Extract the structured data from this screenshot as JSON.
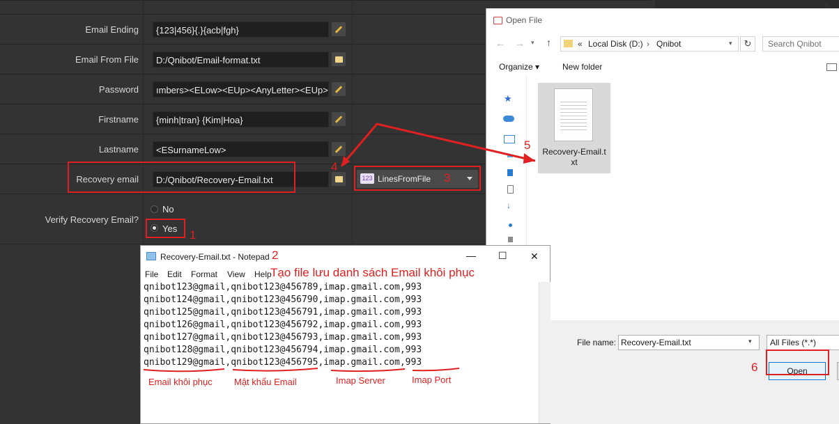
{
  "settings": {
    "rows": [
      {
        "label": "Email Ending",
        "value": "{123|456}{.}{acb|fgh}",
        "button": "pencil"
      },
      {
        "label": "Email From File",
        "value": "D:/Qnibot/Email-format.txt",
        "button": "folder"
      },
      {
        "label": "Password",
        "value": "ımbers><ELow><EUp><AnyLetter><EUp>",
        "button": "pencil"
      },
      {
        "label": "Firstname",
        "value": "{minh|tran} {Kim|Hoa}",
        "button": "pencil"
      },
      {
        "label": "Lastname",
        "value": "<ESurnameLow>",
        "button": "pencil"
      },
      {
        "label": "Recovery email",
        "value": "D:/Qnibot/Recovery-Email.txt",
        "button": "folder"
      }
    ],
    "combo": {
      "badge": "123",
      "value": "LinesFromFile"
    },
    "verify_label": "Verify Recovery Email?",
    "radio_no": "No",
    "radio_yes": "Yes"
  },
  "open_dialog": {
    "title": "Open File",
    "address": {
      "prefix": "«",
      "path1": "Local Disk (D:)",
      "sep": "›",
      "path2": "Qnibot"
    },
    "search_placeholder": "Search Qnibot",
    "organize": "Organize ▾",
    "new_folder": "New folder",
    "file_name": "Recovery-Email.txt",
    "file_name_label": "File name:",
    "file_name_value": "Recovery-Email.txt",
    "file_type": "All Files (*.*)",
    "open_button": "Open"
  },
  "notepad": {
    "title": "Recovery-Email.txt - Notepad",
    "menu": [
      "File",
      "Edit",
      "Format",
      "View",
      "Help"
    ],
    "lines": [
      "qnibot123@gmail,qnibot123@456789,imap.gmail.com,993",
      "qnibot124@gmail,qnibot123@456790,imap.gmail.com,993",
      "qnibot125@gmail,qnibot123@456791,imap.gmail.com,993",
      "qnibot126@gmail,qnibot123@456792,imap.gmail.com,993",
      "qnibot127@gmail,qnibot123@456793,imap.gmail.com,993",
      "qnibot128@gmail,qnibot123@456794,imap.gmail.com,993",
      "qnibot129@gmail,qnibot123@456795,imap.gmail.com,993"
    ],
    "min": "—",
    "max": "☐",
    "close": "✕"
  },
  "annotations": {
    "n1": "1",
    "n2": "2",
    "n3": "3",
    "n4": "4",
    "n5": "5",
    "n6": "6",
    "create_note": "Tạo file lưu danh sách Email khôi phục",
    "col1": "Email khôi phục",
    "col2": "Mật khẩu Email",
    "col3": "Imap Server",
    "col4": "Imap Port"
  },
  "colors": {
    "annotation_red": "#e02020",
    "pencil": "#e3b53c",
    "folder": "#f0d58a"
  }
}
